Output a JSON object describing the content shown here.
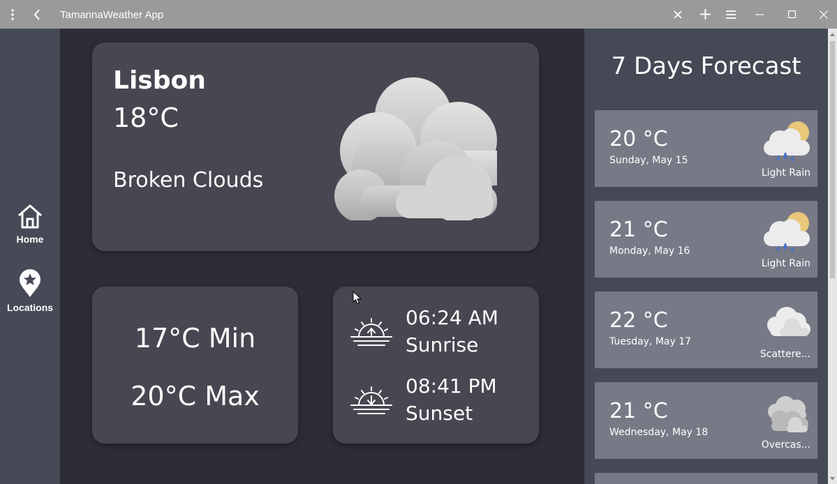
{
  "window": {
    "title": "TamannaWeather App"
  },
  "nav": {
    "items": [
      {
        "label": "Home",
        "icon": "home-icon"
      },
      {
        "label": "Locations",
        "icon": "location-pin-icon"
      }
    ]
  },
  "current": {
    "city": "Lisbon",
    "temp": "18°C",
    "condition": "Broken Clouds",
    "icon": "broken-clouds-icon"
  },
  "minmax": {
    "min": "17°C Min",
    "max": "20°C Max"
  },
  "sun": {
    "sunrise_time": "06:24 AM",
    "sunrise_label": "Sunrise",
    "sunset_time": "08:41 PM",
    "sunset_label": "Sunset"
  },
  "forecast": {
    "title": "7 Days Forecast",
    "days": [
      {
        "temp": "20 °C",
        "date": "Sunday, May 15",
        "desc": "Light Rain",
        "icon": "light-rain-icon"
      },
      {
        "temp": "21 °C",
        "date": "Monday, May 16",
        "desc": "Light Rain",
        "icon": "light-rain-icon"
      },
      {
        "temp": "22 °C",
        "date": "Tuesday, May 17",
        "desc": "Scattere...",
        "icon": "scattered-clouds-icon"
      },
      {
        "temp": "21 °C",
        "date": "Wednesday, May 18",
        "desc": "Overcas...",
        "icon": "overcast-clouds-icon"
      }
    ]
  },
  "colors": {
    "main_bg": "#2d2d37",
    "card_bg": "#474751",
    "rail_bg": "#464a56",
    "forecast_bg": "#454955",
    "forecast_card_bg": "#777a86",
    "titlebar_bg": "#9a9a9a"
  }
}
